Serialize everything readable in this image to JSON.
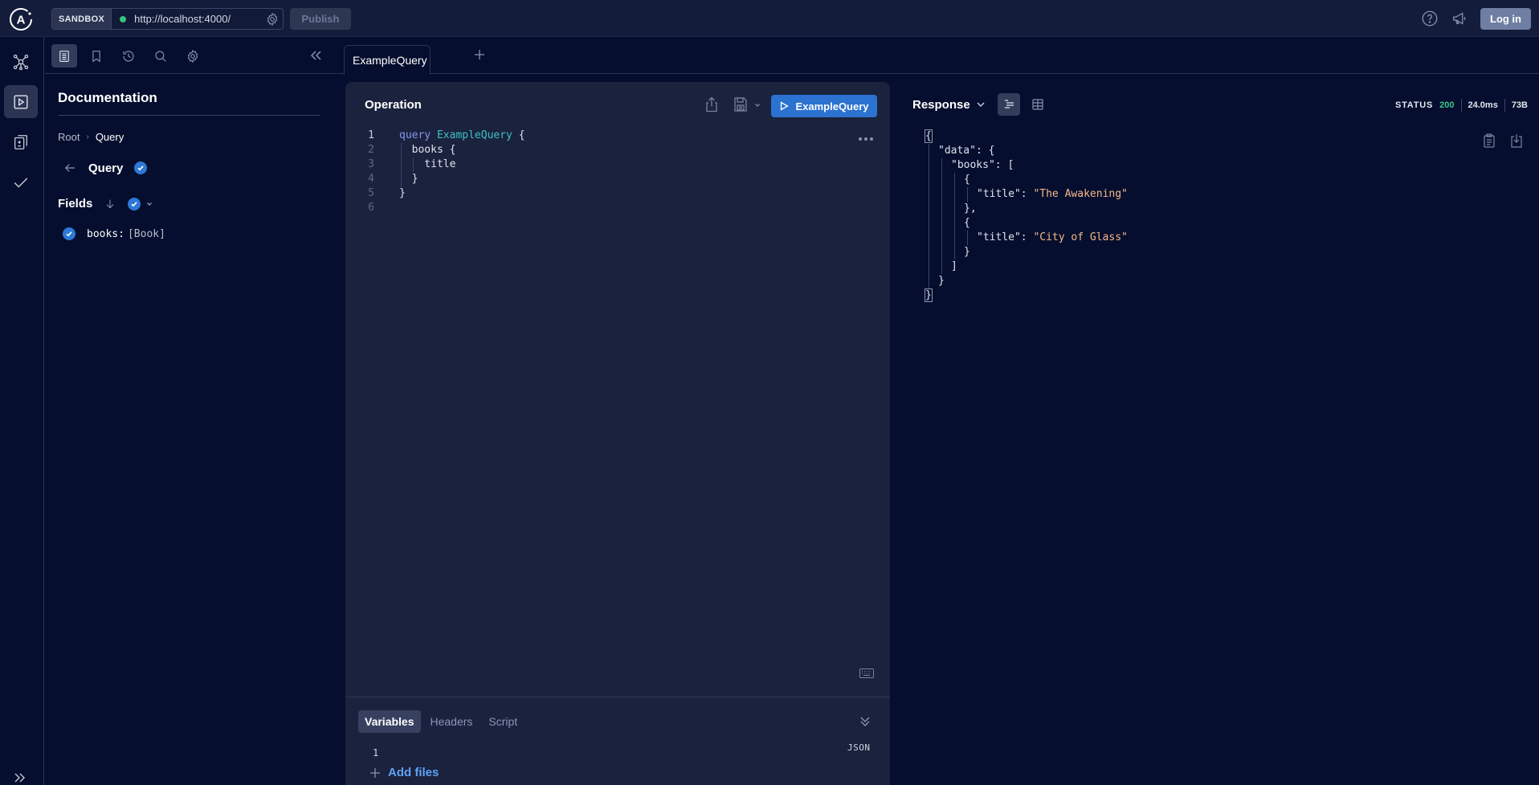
{
  "topbar": {
    "logo": "apollo-logo",
    "env_label": "SANDBOX",
    "endpoint_url": "http://localhost:4000/",
    "endpoint_status_color": "#36c47a",
    "publish_label": "Publish",
    "login_label": "Log in",
    "icons": [
      "gear-icon",
      "help-icon",
      "megaphone-icon"
    ]
  },
  "rail": {
    "items": [
      {
        "name": "schema",
        "icon": "graph-icon",
        "active": false
      },
      {
        "name": "explorer",
        "icon": "play-icon",
        "active": true
      },
      {
        "name": "changelog",
        "icon": "diff-icon",
        "active": false
      },
      {
        "name": "checks",
        "icon": "check-icon",
        "active": false
      }
    ],
    "expand_icon": "double-chevron-right-icon"
  },
  "docs_toolbar": {
    "tools": [
      {
        "name": "documentation",
        "icon": "document-icon",
        "active": true
      },
      {
        "name": "collections",
        "icon": "bookmark-icon",
        "active": false
      },
      {
        "name": "history",
        "icon": "history-icon",
        "active": false
      },
      {
        "name": "search",
        "icon": "search-icon",
        "active": false
      },
      {
        "name": "settings",
        "icon": "gear-icon",
        "active": false
      }
    ],
    "collapse_icon": "double-chevron-left-icon"
  },
  "docs": {
    "title": "Documentation",
    "breadcrumb": {
      "root": "Root",
      "separator": "›",
      "current": "Query"
    },
    "type_name": "Query",
    "fields_label": "Fields",
    "fields": [
      {
        "name": "books:",
        "type": "[Book]",
        "selected": true
      }
    ]
  },
  "tabs": {
    "items": [
      {
        "label": "ExampleQuery",
        "active": true
      }
    ],
    "add_label": "+"
  },
  "operation": {
    "title": "Operation",
    "run_label": "ExampleQuery",
    "run_color": "#2b72d1",
    "code_lines": [
      {
        "n": "1",
        "tokens": [
          {
            "t": "query ",
            "c": "kw"
          },
          {
            "t": "ExampleQuery",
            "c": "op-name"
          },
          {
            "t": " {",
            "c": ""
          }
        ]
      },
      {
        "n": "2",
        "tokens": [
          {
            "t": "  books {",
            "c": ""
          }
        ]
      },
      {
        "n": "3",
        "tokens": [
          {
            "t": "    title",
            "c": ""
          }
        ]
      },
      {
        "n": "4",
        "tokens": [
          {
            "t": "  }",
            "c": ""
          }
        ]
      },
      {
        "n": "5",
        "tokens": [
          {
            "t": "}",
            "c": ""
          }
        ]
      },
      {
        "n": "6",
        "tokens": []
      }
    ],
    "variables_tabs": [
      "Variables",
      "Headers",
      "Script"
    ],
    "active_variables_tab": "Variables",
    "variables_format": "JSON",
    "variables_line_number": "1",
    "add_files_label": "Add files"
  },
  "response": {
    "title": "Response",
    "status_label": "STATUS",
    "status_code": "200",
    "status_color": "#3cc58a",
    "time": "24.0ms",
    "size": "73B",
    "json_lines": [
      {
        "indent": 0,
        "parts": [
          {
            "t": "{",
            "c": "brace-box"
          }
        ]
      },
      {
        "indent": 1,
        "parts": [
          {
            "t": "\"data\"",
            "c": "rk"
          },
          {
            "t": ": {",
            "c": ""
          }
        ]
      },
      {
        "indent": 2,
        "parts": [
          {
            "t": "\"books\"",
            "c": "rk"
          },
          {
            "t": ": [",
            "c": ""
          }
        ]
      },
      {
        "indent": 3,
        "parts": [
          {
            "t": "{",
            "c": ""
          }
        ]
      },
      {
        "indent": 4,
        "parts": [
          {
            "t": "\"title\"",
            "c": "rk"
          },
          {
            "t": ": ",
            "c": ""
          },
          {
            "t": "\"The Awakening\"",
            "c": "rs"
          }
        ]
      },
      {
        "indent": 3,
        "parts": [
          {
            "t": "},",
            "c": ""
          }
        ]
      },
      {
        "indent": 3,
        "parts": [
          {
            "t": "{",
            "c": ""
          }
        ]
      },
      {
        "indent": 4,
        "parts": [
          {
            "t": "\"title\"",
            "c": "rk"
          },
          {
            "t": ": ",
            "c": ""
          },
          {
            "t": "\"City of Glass\"",
            "c": "rs"
          }
        ]
      },
      {
        "indent": 3,
        "parts": [
          {
            "t": "}",
            "c": ""
          }
        ]
      },
      {
        "indent": 2,
        "parts": [
          {
            "t": "]",
            "c": ""
          }
        ]
      },
      {
        "indent": 1,
        "parts": [
          {
            "t": "}",
            "c": ""
          }
        ]
      },
      {
        "indent": 0,
        "parts": [
          {
            "t": "}",
            "c": "brace-box"
          }
        ]
      }
    ]
  }
}
